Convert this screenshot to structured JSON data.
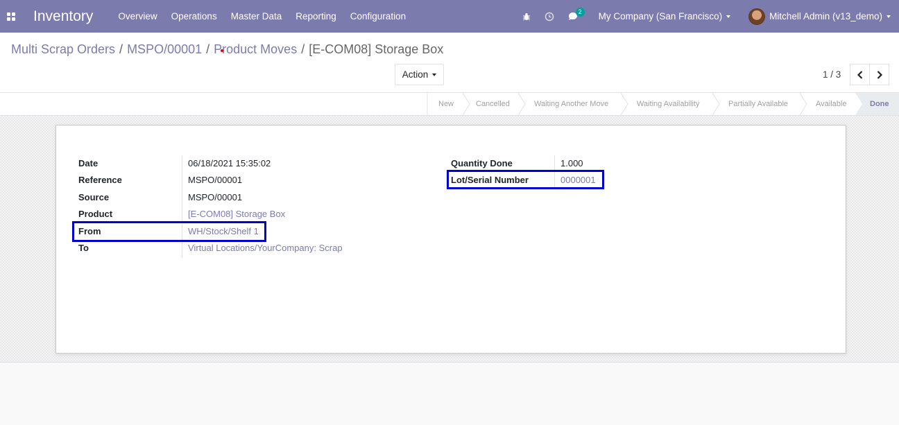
{
  "navbar": {
    "app_title": "Inventory",
    "menu": [
      "Overview",
      "Operations",
      "Master Data",
      "Reporting",
      "Configuration"
    ],
    "messages_badge": "2",
    "company": "My Company (San Francisco)",
    "user": "Mitchell Admin (v13_demo)",
    "icons": [
      "apps-icon",
      "bug-icon",
      "clock-icon",
      "chat-icon"
    ]
  },
  "breadcrumb": {
    "items": [
      "Multi Scrap Orders",
      "MSPO/00001",
      "Product Moves"
    ],
    "current": "[E-COM08] Storage Box",
    "separator": "/"
  },
  "controls": {
    "action_label": "Action",
    "pager": "1 / 3"
  },
  "statusbar": {
    "steps": [
      "New",
      "Cancelled",
      "Waiting Another Move",
      "Waiting Availability",
      "Partially Available",
      "Available"
    ],
    "current": "Done"
  },
  "form": {
    "left": [
      {
        "label": "Date",
        "value": "06/18/2021 15:35:02",
        "link": false
      },
      {
        "label": "Reference",
        "value": "MSPO/00001",
        "link": false
      },
      {
        "label": "Source",
        "value": "MSPO/00001",
        "link": false
      },
      {
        "label": "Product",
        "value": "[E-COM08] Storage Box",
        "link": true
      },
      {
        "label": "From",
        "value": "WH/Stock/Shelf 1",
        "link": true
      },
      {
        "label": "To",
        "value": "Virtual Locations/YourCompany: Scrap",
        "link": true
      }
    ],
    "right": [
      {
        "label": "Quantity Done",
        "value": "1.000",
        "link": false
      },
      {
        "label": "Lot/Serial Number",
        "value": "0000001",
        "link": true
      }
    ]
  },
  "colors": {
    "brand": "#7c7bad",
    "highlight": "#0000cc",
    "badge": "#00a09d"
  }
}
